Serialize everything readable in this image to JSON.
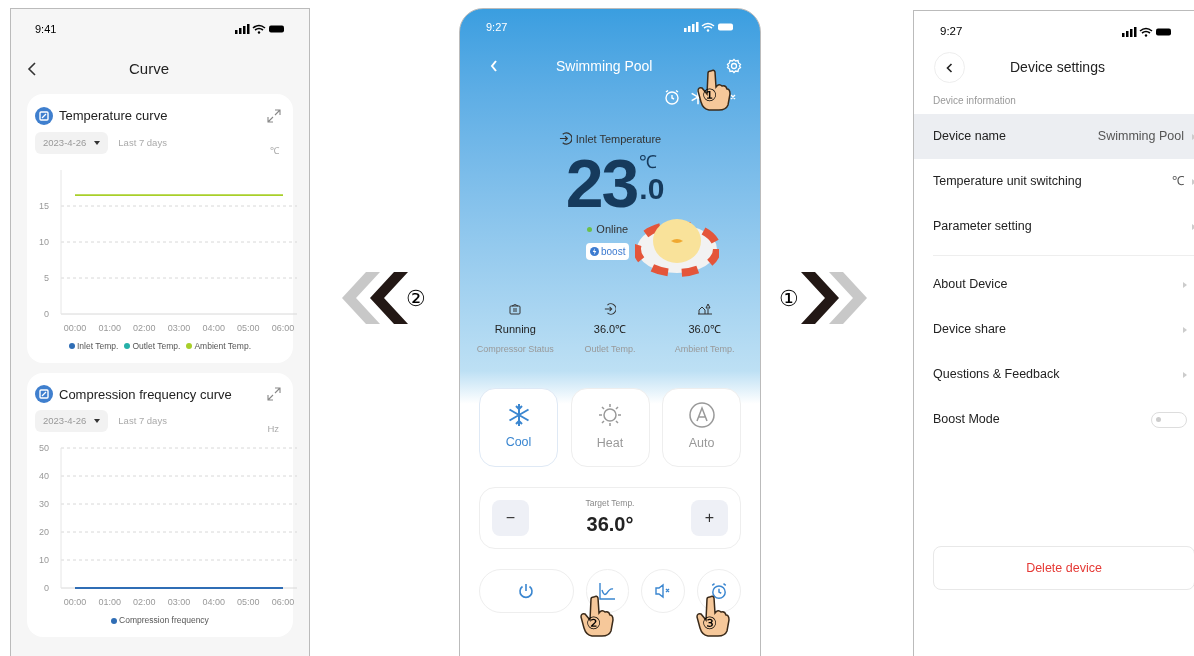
{
  "curve_screen": {
    "status_time": "9:41",
    "title": "Curve",
    "cards": [
      {
        "title": "Temperature curve",
        "date": "2023-4-26",
        "range": "Last 7 days",
        "unit": "℃",
        "chart_data": {
          "type": "line",
          "categories": [
            "00:00",
            "01:00",
            "02:00",
            "03:00",
            "04:00",
            "05:00",
            "06:00"
          ],
          "grid": true,
          "ylim": [
            0,
            20
          ],
          "yticks": [
            0,
            5,
            10,
            15
          ],
          "series": [
            {
              "name": "Inlet Temp.",
              "color": "#2f6db5",
              "values": [
                null,
                null,
                null,
                null,
                null,
                null,
                null
              ]
            },
            {
              "name": "Outlet Temp.",
              "color": "#26b0a8",
              "values": [
                null,
                null,
                null,
                null,
                null,
                null,
                null
              ]
            },
            {
              "name": "Ambient Temp.",
              "color": "#a8cf2a",
              "values": [
                16.5,
                16.5,
                16.5,
                16.5,
                16.5,
                16.5,
                16.5
              ]
            }
          ]
        }
      },
      {
        "title": "Compression frequency curve",
        "date": "2023-4-26",
        "range": "Last 7 days",
        "unit": "Hz",
        "chart_data": {
          "type": "line",
          "categories": [
            "00:00",
            "01:00",
            "02:00",
            "03:00",
            "04:00",
            "05:00",
            "06:00"
          ],
          "grid": true,
          "ylim": [
            0,
            50
          ],
          "yticks": [
            0,
            10,
            20,
            30,
            40,
            50
          ],
          "series": [
            {
              "name": "Compression frequency",
              "color": "#2f6db5",
              "values": [
                0,
                0,
                0,
                0,
                0,
                0,
                0
              ]
            }
          ]
        }
      }
    ]
  },
  "back_arrow": {
    "callout": "②"
  },
  "device_screen": {
    "status_time": "9:27",
    "title": "Swimming Pool",
    "settings_callout": "①",
    "inlet_label": "Inlet Temperature",
    "temp_whole": "23",
    "temp_unit": "℃",
    "temp_fraction": ".0",
    "status": "Online",
    "badge": "boost",
    "stats": [
      {
        "value": "Running",
        "label": "Compressor Status"
      },
      {
        "value": "36.0℃",
        "label": "Outlet Temp."
      },
      {
        "value": "36.0℃",
        "label": "Ambient Temp."
      }
    ],
    "modes": [
      {
        "kind": "cool",
        "label": "Cool",
        "selected": true
      },
      {
        "kind": "heat",
        "label": "Heat",
        "selected": false
      },
      {
        "kind": "auto",
        "label": "Auto",
        "selected": false
      }
    ],
    "target_label": "Target Temp.",
    "target_value": "36.0°",
    "minus": "−",
    "plus": "+",
    "callouts": [
      "②",
      "③"
    ]
  },
  "forward_arrow": {
    "callout": "①"
  },
  "settings_screen": {
    "status_time": "9:27",
    "title": "Device settings",
    "section": "Device information",
    "groups": [
      [
        {
          "kind": "link",
          "label": "Device name",
          "value": "Swimming Pool",
          "highlighted": true
        },
        {
          "kind": "link",
          "label": "Temperature unit switching",
          "value": "℃",
          "highlighted": false
        },
        {
          "kind": "link",
          "label": "Parameter setting",
          "highlighted": false
        }
      ],
      [
        {
          "kind": "link",
          "label": "About Device",
          "highlighted": false
        },
        {
          "kind": "link",
          "label": "Device share",
          "highlighted": false
        },
        {
          "kind": "link",
          "label": "Questions & Feedback",
          "highlighted": false
        },
        {
          "kind": "toggle",
          "label": "Boost Mode",
          "on": false,
          "highlighted": false
        }
      ]
    ],
    "delete_label": "Delete device"
  }
}
